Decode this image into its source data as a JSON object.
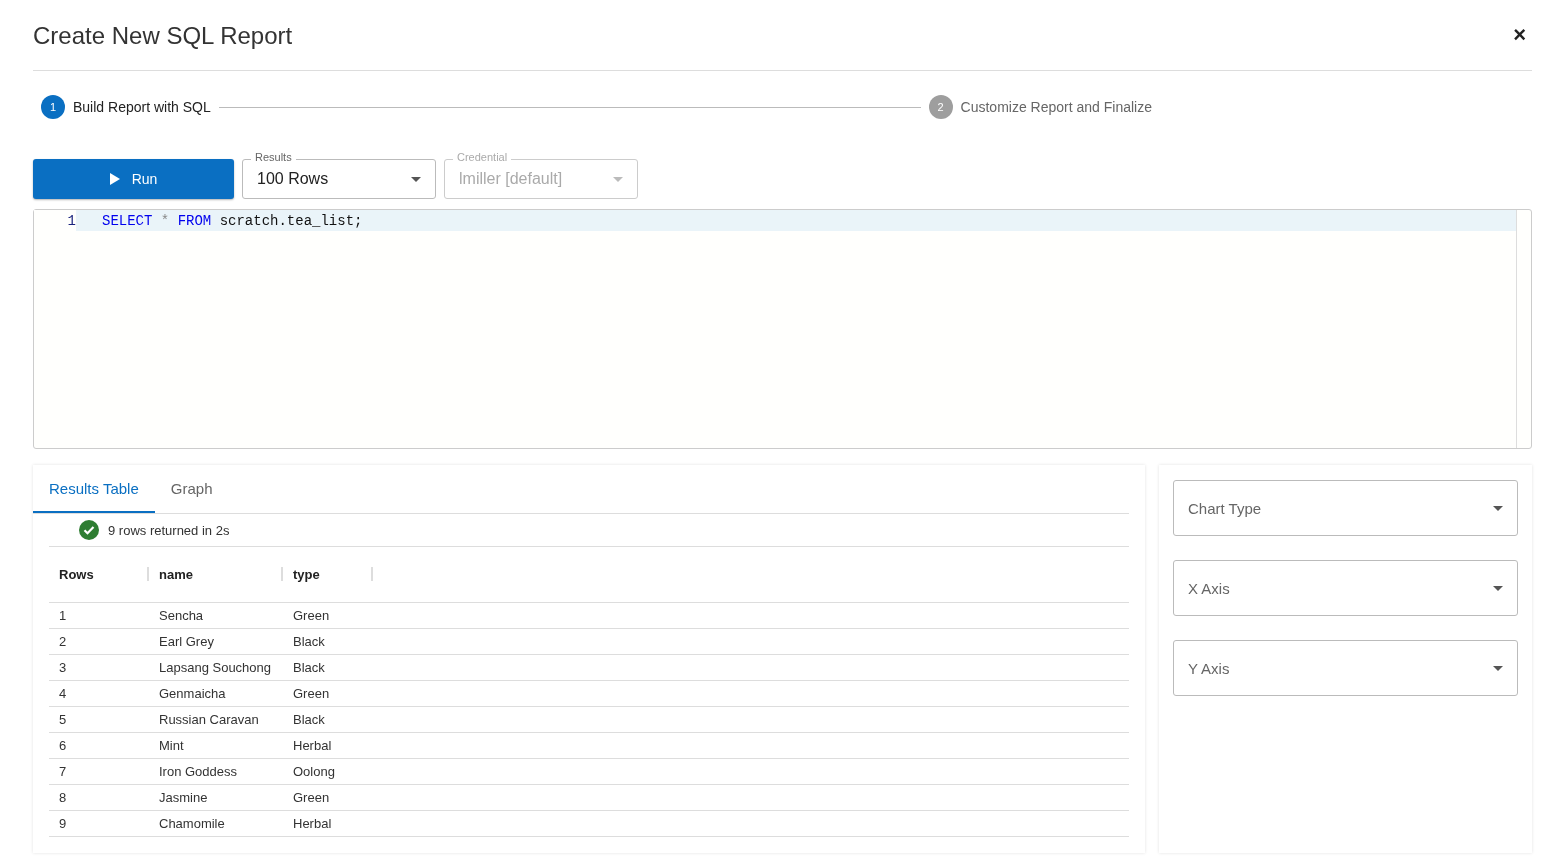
{
  "dialog": {
    "title": "Create New SQL Report",
    "close": "×"
  },
  "steps": [
    {
      "number": "1",
      "label": "Build Report with SQL",
      "selected": true
    },
    {
      "number": "2",
      "label": "Customize Report and Finalize",
      "selected": false
    }
  ],
  "toolbar": {
    "run": "Run",
    "selects": [
      {
        "label": "Results",
        "value": "100 Rows",
        "disabled": false
      },
      {
        "label": "Credential",
        "value": "lmiller [default]",
        "disabled": true
      }
    ]
  },
  "editor": {
    "lines": [
      {
        "number": "1",
        "active": true,
        "tokens": [
          {
            "kind": "keyword",
            "text": "SELECT"
          },
          {
            "kind": "operator",
            "text": "*"
          },
          {
            "kind": "keyword",
            "text": "FROM"
          },
          {
            "kind": "identifier",
            "text": "scratch.tea_list;"
          }
        ]
      }
    ]
  },
  "results": {
    "tabs": [
      {
        "label": "Results Table",
        "selected": true
      },
      {
        "label": "Graph",
        "selected": false
      }
    ],
    "status": "9 rows returned in 2s",
    "columns": [
      "Rows",
      "name",
      "type"
    ],
    "rows": [
      [
        "1",
        "Sencha",
        "Green"
      ],
      [
        "2",
        "Earl Grey",
        "Black"
      ],
      [
        "3",
        "Lapsang Souchong",
        "Black"
      ],
      [
        "4",
        "Genmaicha",
        "Green"
      ],
      [
        "5",
        "Russian Caravan",
        "Black"
      ],
      [
        "6",
        "Mint",
        "Herbal"
      ],
      [
        "7",
        "Iron Goddess",
        "Oolong"
      ],
      [
        "8",
        "Jasmine",
        "Green"
      ],
      [
        "9",
        "Chamomile",
        "Herbal"
      ]
    ]
  },
  "chart_options": [
    {
      "placeholder": "Chart Type"
    },
    {
      "placeholder": "X Axis"
    },
    {
      "placeholder": "Y Axis"
    }
  ]
}
